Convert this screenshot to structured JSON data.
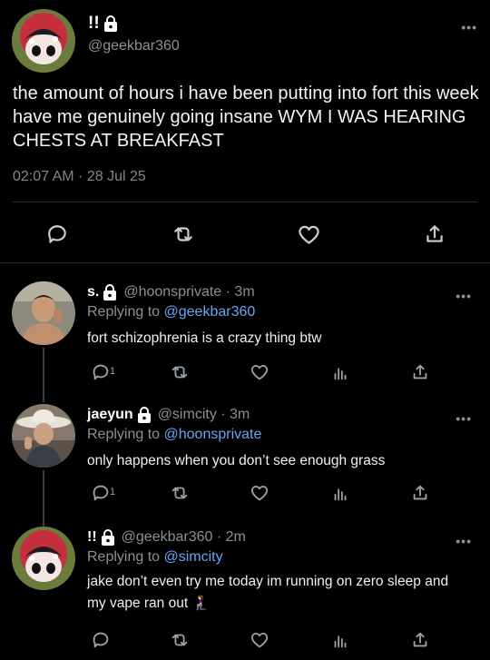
{
  "main_tweet": {
    "display_name": "!!",
    "handle": "@geekbar360",
    "text": "the amount of hours i have been putting into fort this week have me genuinely going insane WYM I WAS HEARING CHESTS AT BREAKFAST",
    "timestamp": "02:07 AM · 28 Jul 25",
    "more_icon": "ellipsis-icon",
    "actions": [
      "reply-icon",
      "retweet-icon",
      "like-icon",
      "share-icon"
    ]
  },
  "replies": [
    {
      "display_name": "s.",
      "handle": "@hoonsprivate · 3m",
      "replying_label": "Replying to",
      "replying_to": "@geekbar360",
      "text": "fort schizophrenia is a crazy thing btw",
      "reply_count": "1"
    },
    {
      "display_name": "jaeyun",
      "handle": "@simcity · 3m",
      "replying_label": "Replying to",
      "replying_to": "@hoonsprivate",
      "text": "only happens when you don’t see enough grass",
      "reply_count": "1"
    },
    {
      "display_name": "!!",
      "handle": "@geekbar360 · 2m",
      "replying_label": "Replying to",
      "replying_to": "@simcity",
      "text": "jake don’t even try me today im running on zero sleep and my vape ran out 🧎‍♀️",
      "reply_count": ""
    }
  ],
  "colors": {
    "background": "#000000",
    "mention": "#6aa6ee",
    "muted": "#8b9095"
  }
}
